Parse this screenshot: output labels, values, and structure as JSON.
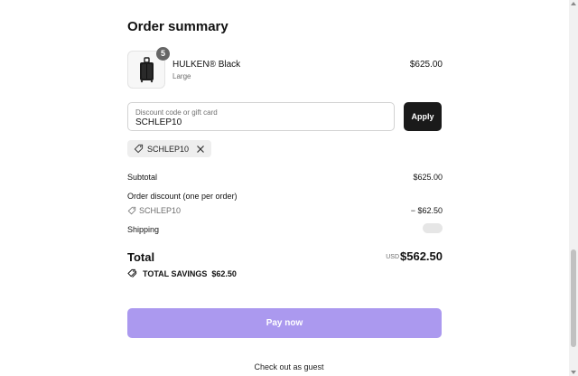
{
  "summary": {
    "title": "Order summary"
  },
  "product": {
    "quantity": "5",
    "name": "HULKEN® Black",
    "variant": "Large",
    "price": "$625.00",
    "image_icon": "bag-icon"
  },
  "discount": {
    "field_label": "Discount code or gift card",
    "field_value": "SCHLEP10",
    "apply_label": "Apply",
    "applied_code": "SCHLEP10",
    "tag_icon": "tag-icon",
    "remove_icon": "close-icon"
  },
  "lines": {
    "subtotal_label": "Subtotal",
    "subtotal_value": "$625.00",
    "order_discount_label": "Order discount (one per order)",
    "order_discount_code": "SCHLEP10",
    "order_discount_value": "− $62.50",
    "shipping_label": "Shipping"
  },
  "total": {
    "label": "Total",
    "currency": "USD",
    "amount": "$562.50"
  },
  "savings": {
    "label": "TOTAL SAVINGS",
    "amount": "$62.50",
    "icon": "tags-icon"
  },
  "actions": {
    "pay_label": "Pay now",
    "guest_label": "Check out as guest"
  },
  "colors": {
    "pay_button": "#ab99ef",
    "apply_button": "#1a1a1a"
  }
}
